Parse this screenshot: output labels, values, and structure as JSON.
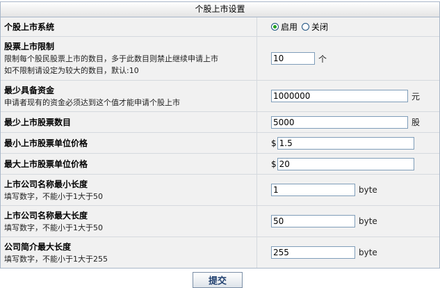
{
  "header": {
    "title": "个股上市设置"
  },
  "rows": [
    {
      "title": "个股上市系统",
      "desc1": "",
      "desc2": ""
    },
    {
      "title": "股票上市限制",
      "desc1": "限制每个股民股票上市的数目，多于此数目则禁止继续申请上市",
      "desc2": "如不限制请设定为较大的数目，默认:10",
      "value": "10",
      "unit": "个"
    },
    {
      "title": "最少具备资金",
      "desc1": "申请者现有的资金必须达到这个值才能申请个股上市",
      "value": "1000000",
      "unit": "元"
    },
    {
      "title": "最少上市股票数目",
      "value": "5000",
      "unit": "股"
    },
    {
      "title": "最小上市股票单位价格",
      "prefix": "$",
      "value": "1.5"
    },
    {
      "title": "最大上市股票单位价格",
      "prefix": "$",
      "value": "20"
    },
    {
      "title": "上市公司名称最小长度",
      "desc1": "填写数字，不能小于1大于50",
      "value": "1",
      "unit": "byte"
    },
    {
      "title": "上市公司名称最大长度",
      "desc1": "填写数字，不能小于1大于50",
      "value": "50",
      "unit": "byte"
    },
    {
      "title": "公司简介最大长度",
      "desc1": "填写数字，不能小于1大于255",
      "value": "255",
      "unit": "byte"
    }
  ],
  "radio": {
    "on_label": "启用",
    "off_label": "关闭",
    "selected": "on"
  },
  "submit": {
    "label": "提交"
  }
}
